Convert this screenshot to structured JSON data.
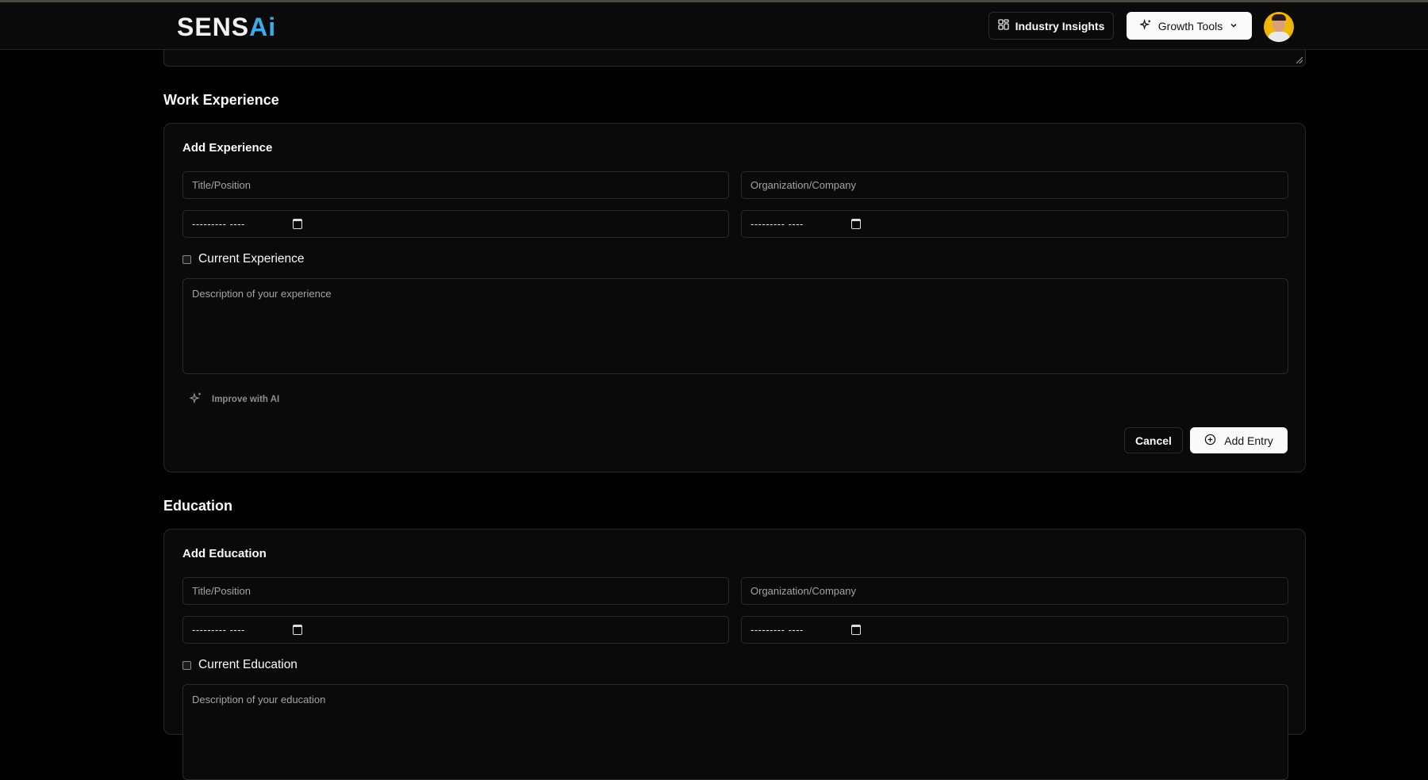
{
  "header": {
    "logo_main": "SENS",
    "logo_accent": "Ai",
    "insights_label": "Industry Insights",
    "growth_label": "Growth Tools"
  },
  "work": {
    "section_title": "Work Experience",
    "card_title": "Add Experience",
    "title_placeholder": "Title/Position",
    "org_placeholder": "Organization/Company",
    "start_date": "--------- ----",
    "end_date": "--------- ----",
    "current_label": "Current Experience",
    "description_placeholder": "Description of your experience",
    "improve_label": "Improve with AI",
    "cancel_label": "Cancel",
    "add_label": "Add Entry"
  },
  "education": {
    "section_title": "Education",
    "card_title": "Add Education",
    "title_placeholder": "Title/Position",
    "org_placeholder": "Organization/Company",
    "start_date": "--------- ----",
    "end_date": "--------- ----",
    "current_label": "Current Education",
    "description_placeholder": "Description of your education"
  },
  "colors": {
    "background": "#000000",
    "card": "#0a0a0a",
    "border": "#262626",
    "accent": "#3ba9ea"
  }
}
